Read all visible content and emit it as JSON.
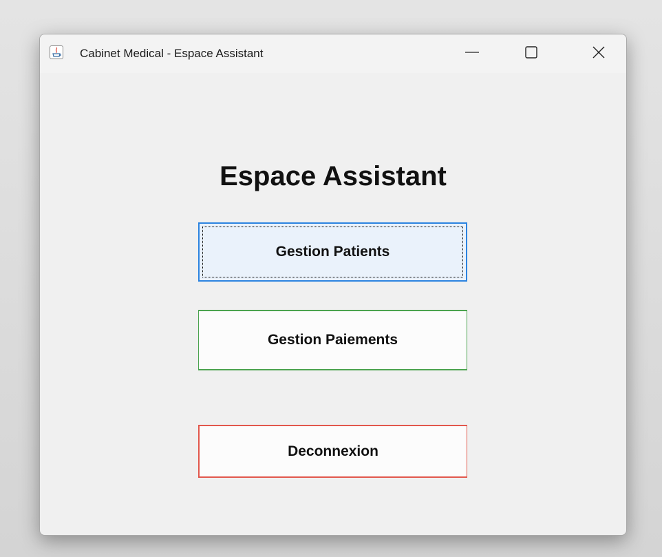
{
  "window": {
    "title": "Cabinet Medical - Espace Assistant",
    "icon": "java-app-icon",
    "controls": [
      "minimize-icon",
      "maximize-icon",
      "close-icon"
    ]
  },
  "main": {
    "heading": "Espace Assistant",
    "buttons": {
      "patients": "Gestion Patients",
      "paiements": "Gestion Paiements",
      "deconnexion": "Deconnexion"
    }
  },
  "colors": {
    "patients_border": "#2b83e0",
    "patients_bg": "#eaf2fb",
    "paiements_border": "#4ba34f",
    "deconnexion_border": "#e2574c"
  }
}
